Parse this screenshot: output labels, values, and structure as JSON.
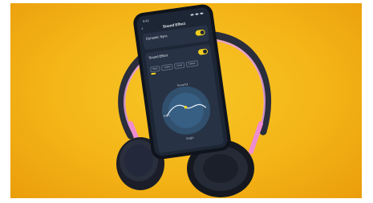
{
  "scene": {
    "background_color": "#f4b517",
    "accent_color": "#f2d61e",
    "headphone_color": "#1f2330",
    "headband_highlight": "#e8a0e0"
  },
  "phone": {
    "status_time": "9:41",
    "nav_title": "Sound Effect",
    "back_icon": "chevron-left-icon",
    "card1": {
      "title": "Dynamic Sync",
      "subtitle": "",
      "toggle_on": true
    },
    "card2": {
      "title": "Sound Effect",
      "subtitle": "",
      "toggle_on": true,
      "chips": [
        "Bass",
        "Treble",
        "Vocal",
        "Classic"
      ],
      "preset_label": "",
      "dial_labels": {
        "top": "Powerful",
        "left": "Bass",
        "right": "",
        "bottom": "Bright"
      }
    }
  }
}
